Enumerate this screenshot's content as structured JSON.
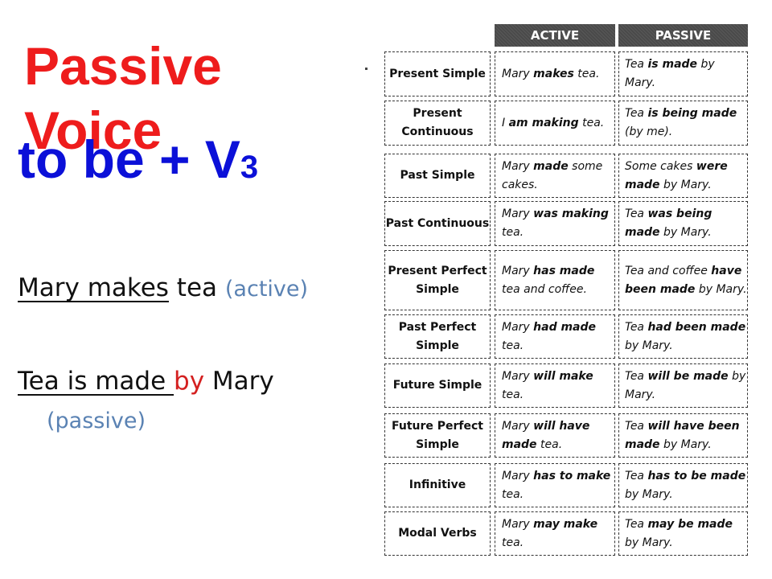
{
  "slide": {
    "title_line1": "Passive",
    "title_line2": "Voice",
    "formula": {
      "text": "to be + V",
      "subscript": "3"
    },
    "example_active": {
      "underlined": "Mary makes",
      "rest": " tea ",
      "note": "(active)"
    },
    "example_passive": {
      "underlined": "Tea is made ",
      "by": "by",
      "rest": " Mary",
      "note": "(passive)"
    },
    "colors": {
      "title": "#ee1c1c",
      "formula": "#0b10d8",
      "note": "#5a82b3",
      "by": "#d42020"
    }
  },
  "table": {
    "headers": {
      "active": "ACTIVE",
      "passive": "PASSIVE"
    },
    "rows": [
      {
        "tense": "Present Simple",
        "active": [
          [
            "Mary ",
            0
          ],
          [
            "makes",
            1
          ],
          [
            " tea.",
            0
          ]
        ],
        "passive": [
          [
            "Tea ",
            0
          ],
          [
            "is made",
            1
          ],
          [
            " by Mary.",
            0
          ]
        ]
      },
      {
        "tense": "Present Continuous",
        "active": [
          [
            "I ",
            0
          ],
          [
            "am making",
            1
          ],
          [
            " tea.",
            0
          ]
        ],
        "passive": [
          [
            "Tea ",
            0
          ],
          [
            "is being made",
            1
          ],
          [
            " (by me).",
            0
          ]
        ]
      },
      {
        "tense": "Past Simple",
        "active": [
          [
            "Mary ",
            0
          ],
          [
            "made",
            1
          ],
          [
            " some cakes.",
            0
          ]
        ],
        "passive": [
          [
            "Some cakes ",
            0
          ],
          [
            "were made",
            1
          ],
          [
            " by Mary.",
            0
          ]
        ]
      },
      {
        "tense": "Past Continuous",
        "active": [
          [
            "Mary ",
            0
          ],
          [
            "was making",
            1
          ],
          [
            " tea.",
            0
          ]
        ],
        "passive": [
          [
            "Tea ",
            0
          ],
          [
            "was being made",
            1
          ],
          [
            " by Mary.",
            0
          ]
        ]
      },
      {
        "tense": "Present Perfect Simple",
        "active": [
          [
            "Mary ",
            0
          ],
          [
            "has made",
            1
          ],
          [
            " tea and coffee.",
            0
          ]
        ],
        "passive": [
          [
            "Tea and coffee ",
            0
          ],
          [
            "have been made",
            1
          ],
          [
            " by Mary.",
            0
          ]
        ]
      },
      {
        "tense": "Past Perfect Simple",
        "active": [
          [
            "Mary ",
            0
          ],
          [
            "had made",
            1
          ],
          [
            " tea.",
            0
          ]
        ],
        "passive": [
          [
            "Tea ",
            0
          ],
          [
            "had been made",
            1
          ],
          [
            " by Mary.",
            0
          ]
        ]
      },
      {
        "tense": "Future Simple",
        "active": [
          [
            "Mary ",
            0
          ],
          [
            "will make",
            1
          ],
          [
            " tea.",
            0
          ]
        ],
        "passive": [
          [
            "Tea ",
            0
          ],
          [
            "will be made",
            1
          ],
          [
            " by Mary.",
            0
          ]
        ]
      },
      {
        "tense": "Future Perfect Simple",
        "active": [
          [
            "Mary ",
            0
          ],
          [
            "will have made",
            1
          ],
          [
            " tea.",
            0
          ]
        ],
        "passive": [
          [
            "Tea ",
            0
          ],
          [
            "will have been made",
            1
          ],
          [
            " by Mary.",
            0
          ]
        ]
      },
      {
        "tense": "Infinitive",
        "active": [
          [
            "Mary ",
            0
          ],
          [
            "has to make",
            1
          ],
          [
            " tea.",
            0
          ]
        ],
        "passive": [
          [
            "Tea ",
            0
          ],
          [
            "has to be made",
            1
          ],
          [
            " by Mary.",
            0
          ]
        ]
      },
      {
        "tense": "Modal Verbs",
        "active": [
          [
            "Mary ",
            0
          ],
          [
            "may make",
            1
          ],
          [
            " tea.",
            0
          ]
        ],
        "passive": [
          [
            "Tea ",
            0
          ],
          [
            "may be made",
            1
          ],
          [
            " by Mary.",
            0
          ]
        ]
      }
    ]
  }
}
